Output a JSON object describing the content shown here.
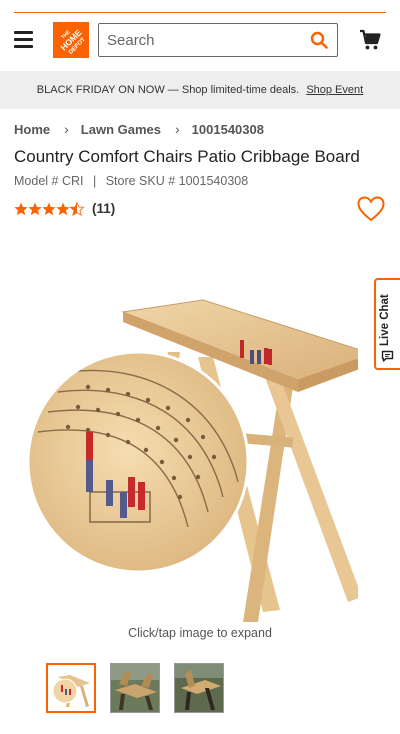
{
  "colors": {
    "brand": "#f96302",
    "banner_bg": "#eeeeee"
  },
  "header": {
    "logo_text": "THE HOME DEPOT",
    "search_placeholder": "Search",
    "icons": [
      "menu-icon",
      "search-icon",
      "cart-icon"
    ]
  },
  "banner": {
    "text": "BLACK FRIDAY ON NOW — Shop limited-time deals.",
    "link": "Shop Event"
  },
  "breadcrumb": [
    "Home",
    "Lawn Games",
    "1001540308"
  ],
  "product": {
    "title": "Country Comfort Chairs Patio Cribbage Board",
    "model": "Model # CRI",
    "sku": "Store SKU # 1001540308",
    "rating": 4.5,
    "rating_count": "(11)",
    "caption": "Click/tap image to expand"
  },
  "live_chat": {
    "label": "Live Chat"
  },
  "thumbnails": [
    {
      "name": "thumbnail-1",
      "selected": true
    },
    {
      "name": "thumbnail-2",
      "selected": false
    },
    {
      "name": "thumbnail-3",
      "selected": false
    }
  ]
}
